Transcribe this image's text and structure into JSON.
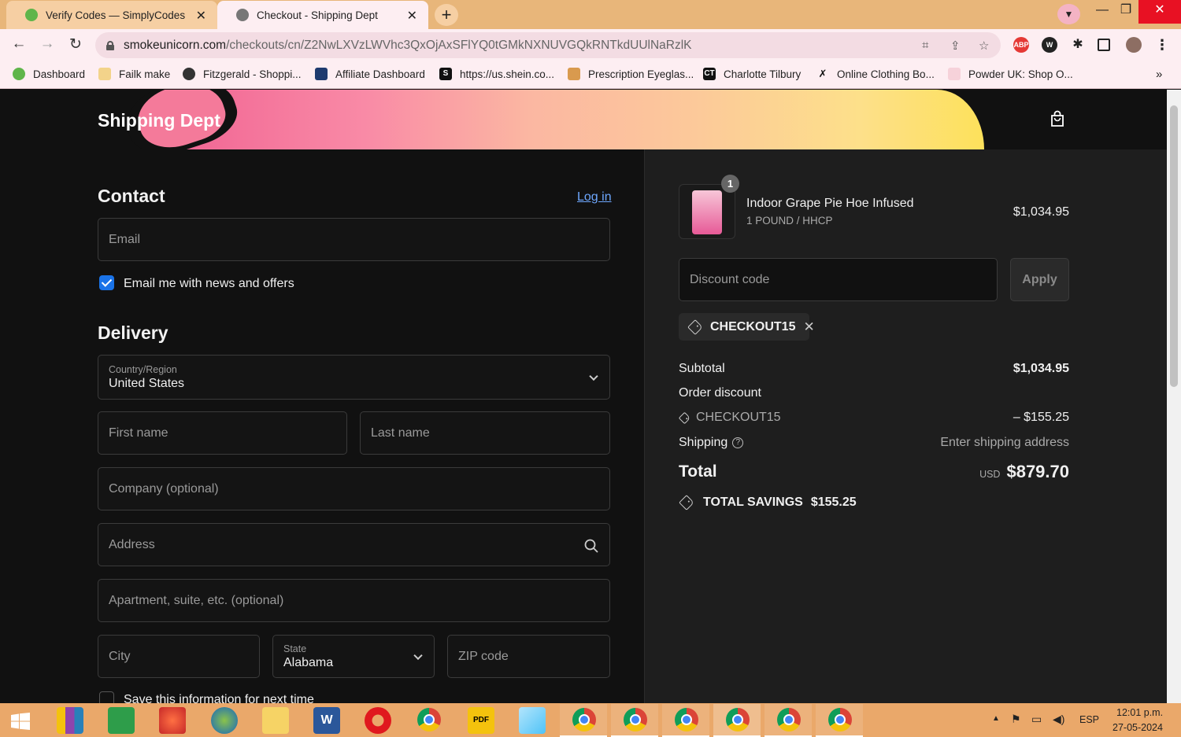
{
  "browser": {
    "tabs": [
      {
        "title": "Verify Codes — SimplyCodes",
        "close": "✕"
      },
      {
        "title": "Checkout - Shipping Dept",
        "close": "✕"
      }
    ],
    "new_tab": "+",
    "url_host": "smokeunicorn.com",
    "url_path": "/checkouts/cn/Z2NwLXVzLWVhc3QxOjAxSFlYQ0tGMkNXNUVGQkRNTkdUUlNaRzlK",
    "bookmarks": [
      {
        "label": "Dashboard"
      },
      {
        "label": "Failk make"
      },
      {
        "label": "Fitzgerald - Shoppi..."
      },
      {
        "label": "Affiliate Dashboard"
      },
      {
        "label": "https://us.shein.co..."
      },
      {
        "label": "Prescription Eyeglas..."
      },
      {
        "label": "Charlotte Tilbury"
      },
      {
        "label": "Online Clothing Bo..."
      },
      {
        "label": "Powder UK: Shop O..."
      }
    ],
    "more_bookmarks": "»"
  },
  "store": {
    "name": "Shipping Dept"
  },
  "contact": {
    "heading": "Contact",
    "login": "Log in",
    "email_placeholder": "Email",
    "newsletter_label": "Email me with news and offers"
  },
  "delivery": {
    "heading": "Delivery",
    "country_label": "Country/Region",
    "country_value": "United States",
    "first_name": "First name",
    "last_name": "Last name",
    "company": "Company (optional)",
    "address": "Address",
    "apartment": "Apartment, suite, etc. (optional)",
    "city": "City",
    "state_label": "State",
    "state_value": "Alabama",
    "zip": "ZIP code",
    "save_info": "Save this information for next time"
  },
  "summary": {
    "item": {
      "quantity": "1",
      "name": "Indoor Grape Pie Hoe Infused",
      "variant": "1 POUND / HHCP",
      "price": "$1,034.95"
    },
    "discount_placeholder": "Discount code",
    "apply": "Apply",
    "applied_code": "CHECKOUT15",
    "subtotal_label": "Subtotal",
    "subtotal_value": "$1,034.95",
    "order_discount_label": "Order discount",
    "discount_code": "CHECKOUT15",
    "discount_value": "– $155.25",
    "shipping_label": "Shipping",
    "shipping_value": "Enter shipping address",
    "total_label": "Total",
    "currency": "USD",
    "total_value": "$879.70",
    "savings_label": "TOTAL SAVINGS",
    "savings_value": "$155.25"
  },
  "taskbar": {
    "language": "ESP",
    "time": "12:01 p.m.",
    "date": "27-05-2024"
  }
}
